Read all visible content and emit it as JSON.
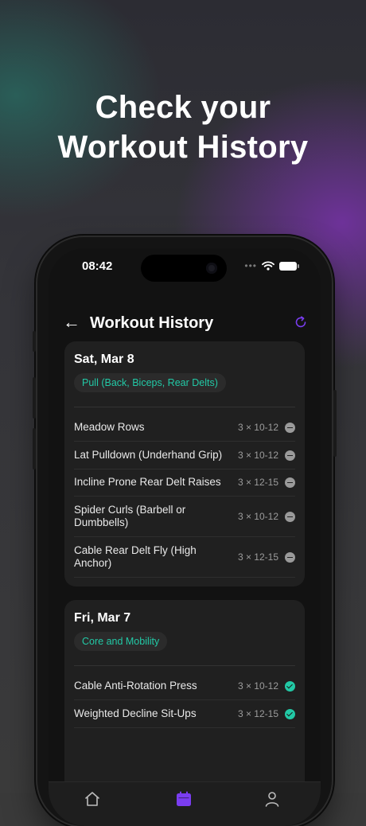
{
  "headline": {
    "line1": "Check your",
    "line2": "Workout History"
  },
  "status_bar": {
    "time": "08:42"
  },
  "nav": {
    "title": "Workout History"
  },
  "colors": {
    "accent": "#7a3df0",
    "teal": "#22c9a6"
  },
  "workouts": [
    {
      "date": "Sat, Mar 8",
      "tag": "Pull (Back, Biceps, Rear Delts)",
      "exercises": [
        {
          "name": "Meadow Rows",
          "sets": "3 × 10-12",
          "status": "skipped"
        },
        {
          "name": "Lat Pulldown (Underhand Grip)",
          "sets": "3 × 10-12",
          "status": "skipped"
        },
        {
          "name": "Incline Prone Rear Delt Raises",
          "sets": "3 × 12-15",
          "status": "skipped"
        },
        {
          "name": "Spider Curls (Barbell or Dumbbells)",
          "sets": "3 × 10-12",
          "status": "skipped"
        },
        {
          "name": "Cable Rear Delt Fly (High Anchor)",
          "sets": "3 × 12-15",
          "status": "skipped"
        }
      ]
    },
    {
      "date": "Fri, Mar 7",
      "tag": "Core and Mobility",
      "exercises": [
        {
          "name": "Cable Anti-Rotation Press",
          "sets": "3 × 10-12",
          "status": "done"
        },
        {
          "name": "Weighted Decline Sit-Ups",
          "sets": "3 × 12-15",
          "status": "done"
        }
      ]
    }
  ],
  "icons": {
    "back": "arrow-left-icon",
    "refresh": "refresh-icon",
    "tab_home": "home-icon",
    "tab_history": "calendar-icon",
    "tab_profile": "user-icon"
  }
}
